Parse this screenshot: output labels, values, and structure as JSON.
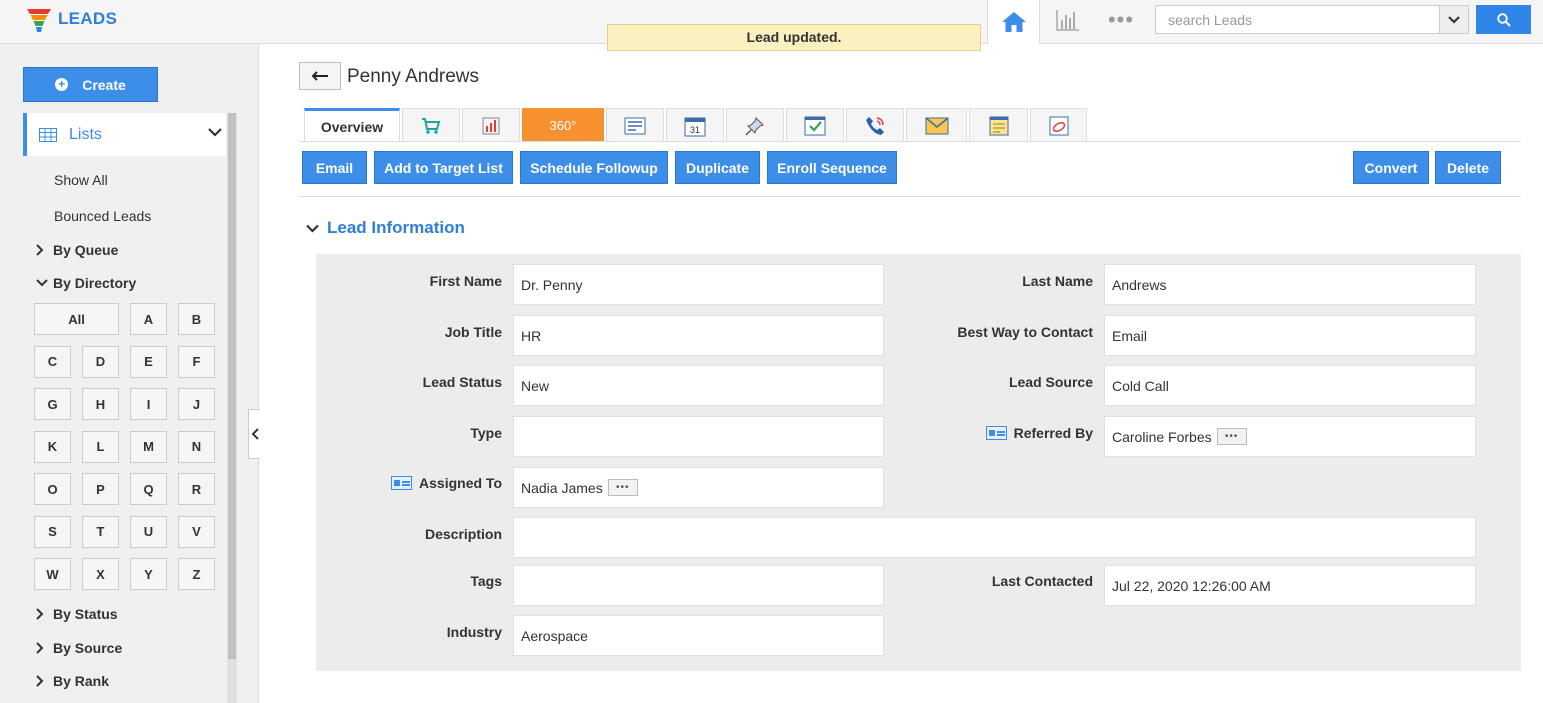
{
  "app": {
    "title": "LEADS"
  },
  "toast": {
    "message": "Lead updated."
  },
  "header": {
    "search_placeholder": "search Leads",
    "icons": [
      "home-icon",
      "chart-icon",
      "more-icon",
      "chevron-down-icon",
      "search-icon"
    ]
  },
  "sidebar": {
    "create_label": "Create",
    "lists_label": "Lists",
    "links": [
      "Show All",
      "Bounced Leads"
    ],
    "groups": {
      "queue": "By Queue",
      "directory": "By Directory",
      "status": "By Status",
      "source": "By Source",
      "rank": "By Rank"
    },
    "directory_buttons": [
      "All",
      "A",
      "B",
      "C",
      "D",
      "E",
      "F",
      "G",
      "H",
      "I",
      "J",
      "K",
      "L",
      "M",
      "N",
      "O",
      "P",
      "Q",
      "R",
      "S",
      "T",
      "U",
      "V",
      "W",
      "X",
      "Y",
      "Z"
    ]
  },
  "record": {
    "title": "Penny Andrews",
    "tabs": {
      "overview": "Overview",
      "tab_360": "360°",
      "icons": [
        "cart-icon",
        "report-icon",
        "360-icon",
        "document-icon",
        "calendar-icon",
        "pin-icon",
        "task-icon",
        "phone-icon",
        "mail-icon",
        "note-icon",
        "attachment-icon"
      ]
    },
    "calendar_day": "31",
    "actions": {
      "email": "Email",
      "add_target": "Add to Target List",
      "schedule": "Schedule Followup",
      "duplicate": "Duplicate",
      "enroll": "Enroll Sequence",
      "convert": "Convert",
      "delete": "Delete"
    }
  },
  "section": {
    "title": "Lead Information"
  },
  "fields": {
    "first_name": {
      "label": "First Name",
      "value": "Dr. Penny"
    },
    "last_name": {
      "label": "Last Name",
      "value": "Andrews"
    },
    "job_title": {
      "label": "Job Title",
      "value": "HR"
    },
    "best_way": {
      "label": "Best Way to Contact",
      "value": "Email"
    },
    "lead_status": {
      "label": "Lead Status",
      "value": "New"
    },
    "lead_source": {
      "label": "Lead Source",
      "value": "Cold Call"
    },
    "type": {
      "label": "Type",
      "value": ""
    },
    "referred_by": {
      "label": "Referred By",
      "value": "Caroline Forbes"
    },
    "assigned_to": {
      "label": "Assigned To",
      "value": "Nadia James"
    },
    "description": {
      "label": "Description",
      "value": ""
    },
    "tags": {
      "label": "Tags",
      "value": ""
    },
    "last_contacted": {
      "label": "Last Contacted",
      "value": "Jul 22, 2020 12:26:00 AM"
    },
    "industry": {
      "label": "Industry",
      "value": "Aerospace"
    }
  },
  "colors": {
    "primary": "#3d8ee8",
    "accent_orange": "#f7902f",
    "toast_bg": "#faf0c0"
  }
}
